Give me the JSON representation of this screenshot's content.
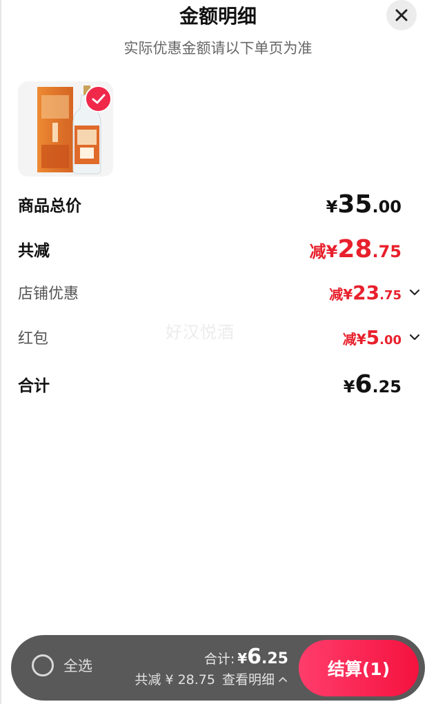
{
  "header": {
    "title": "金额明细",
    "subtitle": "实际优惠金额请以下单页为准"
  },
  "rows": {
    "total_price": {
      "label": "商品总价",
      "prefix": "¥",
      "int": "35",
      "dec": ".00"
    },
    "total_discount": {
      "label": "共减",
      "prefix": "减¥",
      "int": "28",
      "dec": ".75"
    },
    "shop_discount": {
      "label": "店铺优惠",
      "prefix": "减¥",
      "int": "23",
      "dec": ".75"
    },
    "red_packet": {
      "label": "红包",
      "prefix": "减¥",
      "int": "5",
      "dec": ".00"
    },
    "grand_total": {
      "label": "合计",
      "prefix": "¥",
      "int": "6",
      "dec": ".25"
    }
  },
  "watermark": "好汉悦酒",
  "bottom_bar": {
    "select_all": "全选",
    "total_label": "合计:",
    "total_prefix": "¥",
    "total_int": "6",
    "total_dec": ".25",
    "discount_text": "共减 ¥ 28.75",
    "detail_text": "查看明细",
    "checkout": "结算(1)"
  },
  "colors": {
    "accent_red": "#e8202c",
    "checkout_start": "#ff3d6b",
    "checkout_end": "#f5123f",
    "bar_bg": "#595959"
  },
  "icons": {
    "close": "close-icon",
    "check": "check-icon",
    "chevron_down": "chevron-down-icon",
    "chevron_up": "chevron-up-icon"
  }
}
